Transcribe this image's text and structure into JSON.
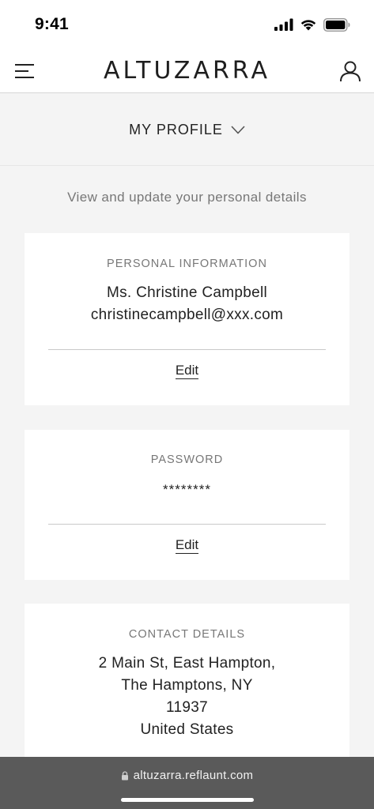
{
  "status_bar": {
    "time": "9:41"
  },
  "header": {
    "brand": "ALTUZARRA"
  },
  "section": {
    "title": "MY PROFILE"
  },
  "subtitle": "View and update your personal details",
  "personal_information": {
    "label": "PERSONAL INFORMATION",
    "name": "Ms. Christine Campbell",
    "email": "christinecampbell@xxx.com",
    "edit_label": "Edit"
  },
  "password": {
    "label": "PASSWORD",
    "value": "********",
    "edit_label": "Edit"
  },
  "contact_details": {
    "label": "CONTACT DETAILS",
    "address_lines": [
      "2 Main St, East Hampton,",
      "The Hamptons, NY",
      "11937",
      "United States"
    ]
  },
  "browser": {
    "url": "altuzarra.reflaunt.com"
  }
}
